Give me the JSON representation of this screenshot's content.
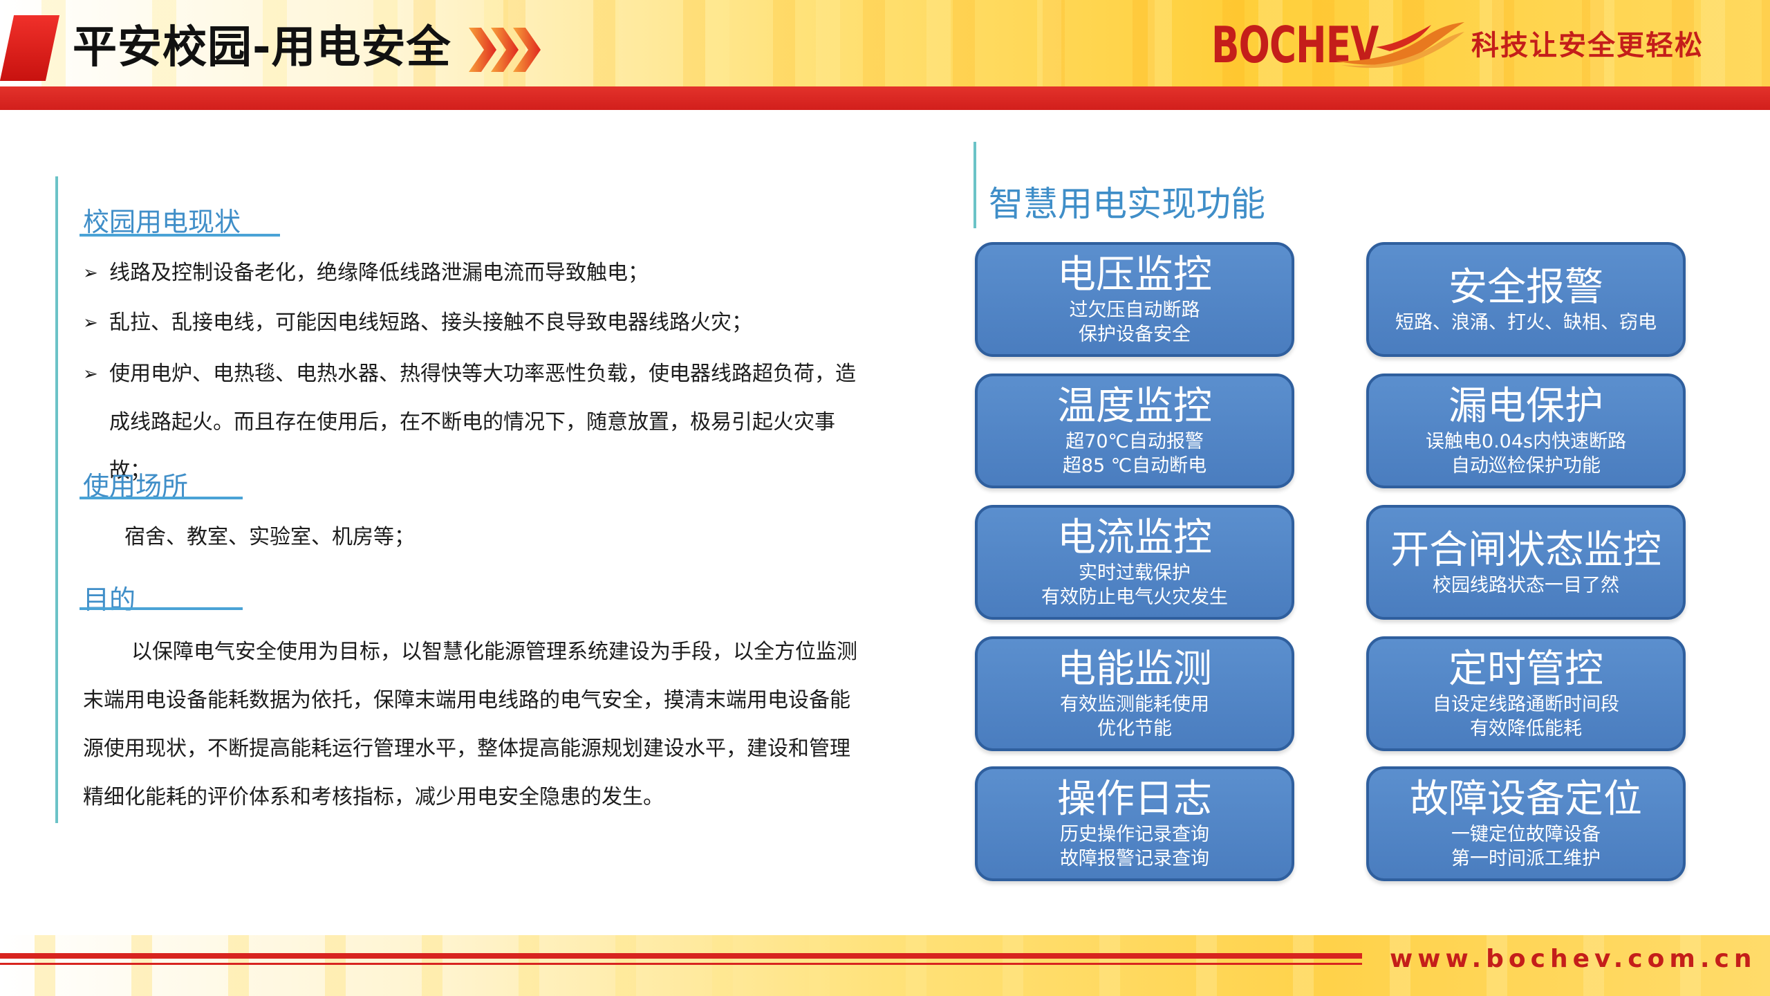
{
  "header": {
    "title": "平安校园-用电安全",
    "brand": "BOCHEV",
    "slogan": "科技让安全更轻松",
    "colors": {
      "brand_red": "#c41e1a",
      "stripe_red": "#d8241f",
      "gold": "#ffd24a"
    }
  },
  "left": {
    "status": {
      "heading": "校园用电现状",
      "bullets": [
        "线路及控制设备老化，绝缘降低线路泄漏电流而导致触电；",
        "乱拉、乱接电线，可能因电线短路、接头接触不良导致电器线路火灾；",
        "使用电炉、电热毯、电热水器、热得快等大功率恶性负载，使电器线路超负荷，造成线路起火。而且存在使用后，在不断电的情况下，随意放置，极易引起火灾事故；"
      ]
    },
    "places": {
      "heading": "使用场所",
      "text": "宿舍、教室、实验室、机房等；"
    },
    "purpose": {
      "heading": "目的",
      "text": "以保障电气安全使用为目标，以智慧化能源管理系统建设为手段，以全方位监测末端用电设备能耗数据为依托，保障末端用电线路的电气安全，摸清末端用电设备能源使用现状，不断提高能耗运行管理水平，整体提高能源规划建设水平，建设和管理精细化能耗的评价体系和考核指标，减少用电安全隐患的发生。"
    }
  },
  "right": {
    "heading": "智慧用电实现功能",
    "features": [
      {
        "title": "电压监控",
        "lines": [
          "过欠压自动断路",
          "保护设备安全"
        ]
      },
      {
        "title": "安全报警",
        "lines": [
          "短路、浪涌、打火、缺相、窃电"
        ]
      },
      {
        "title": "温度监控",
        "lines": [
          "超70℃自动报警",
          "超85 ℃自动断电"
        ]
      },
      {
        "title": "漏电保护",
        "lines": [
          "误触电0.04s内快速断路",
          "自动巡检保护功能"
        ]
      },
      {
        "title": "电流监控",
        "lines": [
          "实时过载保护",
          "有效防止电气火灾发生"
        ]
      },
      {
        "title": "开合闸状态监控",
        "lines": [
          "校园线路状态一目了然"
        ]
      },
      {
        "title": "电能监测",
        "lines": [
          "有效监测能耗使用",
          "优化节能"
        ]
      },
      {
        "title": "定时管控",
        "lines": [
          "自设定线路通断时间段",
          "有效降低能耗"
        ]
      },
      {
        "title": "操作日志",
        "lines": [
          "历史操作记录查询",
          "故障报警记录查询"
        ]
      },
      {
        "title": "故障设备定位",
        "lines": [
          "一键定位故障设备",
          "第一时间派工维护"
        ]
      }
    ]
  },
  "footer": {
    "website": "www.bochev.com.cn"
  }
}
